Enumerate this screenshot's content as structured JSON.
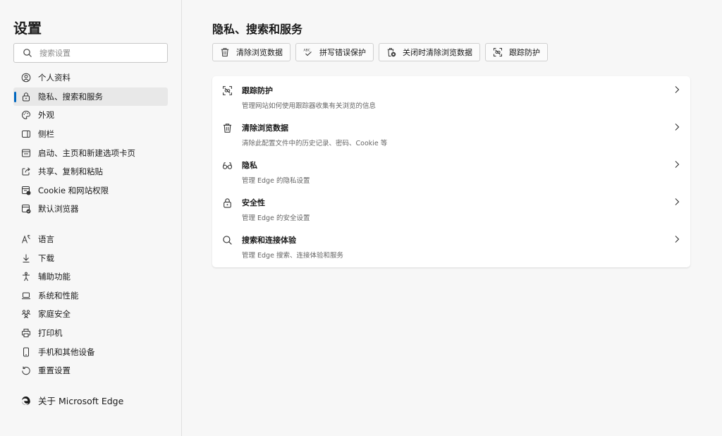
{
  "sidebar": {
    "title": "设置",
    "search_placeholder": "搜索设置",
    "items": [
      {
        "label": "个人资料",
        "icon": "profile-icon"
      },
      {
        "label": "隐私、搜索和服务",
        "icon": "lock-icon",
        "active": true
      },
      {
        "label": "外观",
        "icon": "palette-icon"
      },
      {
        "label": "侧栏",
        "icon": "sidebar-icon"
      },
      {
        "label": "启动、主页和新建选项卡页",
        "icon": "window-icon"
      },
      {
        "label": "共享、复制和粘贴",
        "icon": "share-icon"
      },
      {
        "label": "Cookie 和网站权限",
        "icon": "site-permissions-icon"
      },
      {
        "label": "默认浏览器",
        "icon": "default-browser-icon"
      }
    ],
    "items2": [
      {
        "label": "语言",
        "icon": "language-icon"
      },
      {
        "label": "下载",
        "icon": "download-icon"
      },
      {
        "label": "辅助功能",
        "icon": "accessibility-icon"
      },
      {
        "label": "系统和性能",
        "icon": "laptop-icon"
      },
      {
        "label": "家庭安全",
        "icon": "family-icon"
      },
      {
        "label": "打印机",
        "icon": "printer-icon"
      },
      {
        "label": "手机和其他设备",
        "icon": "phone-icon"
      },
      {
        "label": "重置设置",
        "icon": "reset-icon"
      }
    ],
    "about": {
      "label": "关于 Microsoft Edge",
      "icon": "edge-logo-icon"
    }
  },
  "main": {
    "title": "隐私、搜索和服务",
    "quick_buttons": [
      {
        "label": "清除浏览数据",
        "icon": "trash-icon"
      },
      {
        "label": "拼写错误保护",
        "icon": "spellcheck-icon"
      },
      {
        "label": "关闭时清除浏览数据",
        "icon": "clear-on-close-icon"
      },
      {
        "label": "跟踪防护",
        "icon": "tracking-icon"
      }
    ],
    "rows": [
      {
        "title": "跟踪防护",
        "desc": "管理网站如何使用跟踪器收集有关浏览的信息",
        "icon": "tracking-icon"
      },
      {
        "title": "清除浏览数据",
        "desc": "清除此配置文件中的历史记录、密码、Cookie 等",
        "icon": "trash-icon"
      },
      {
        "title": "隐私",
        "desc": "管理 Edge 的隐私设置",
        "icon": "glasses-icon"
      },
      {
        "title": "安全性",
        "desc": "管理 Edge 的安全设置",
        "icon": "lock-icon"
      },
      {
        "title": "搜索和连接体验",
        "desc": "管理 Edge 搜索、连接体验和服务",
        "icon": "search-icon"
      }
    ]
  },
  "colors": {
    "accent": "#0067c0",
    "sidebar_bg": "#f7f7f7",
    "card_bg": "#ffffff"
  }
}
